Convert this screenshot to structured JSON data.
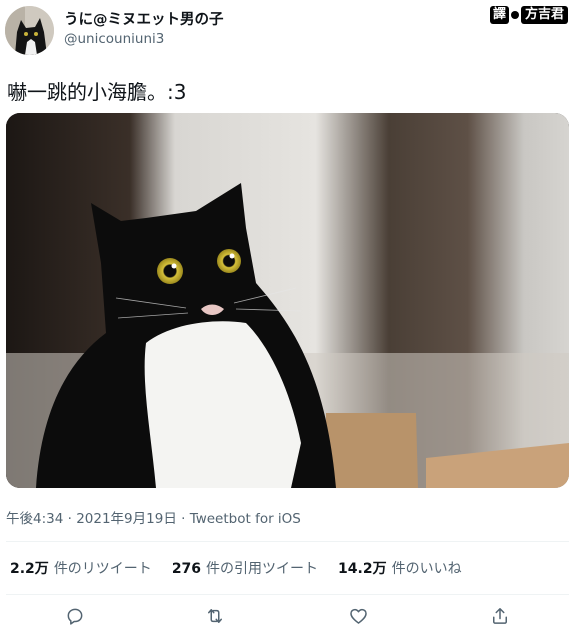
{
  "header": {
    "display_name": "うに@ミヌエット男の子",
    "username": "@unicouniuni3",
    "watermark": {
      "char": "譯",
      "name": "方吉君"
    }
  },
  "tweet": {
    "text": "嚇一跳的小海膽。:3",
    "image_icon": "tuxedo-cat-photo"
  },
  "meta": {
    "time": "午後4:34",
    "separator": " · ",
    "date": "2021年9月19日",
    "source": "Tweetbot for iOS"
  },
  "stats": [
    {
      "value": "2.2万",
      "label": "件のリツイート"
    },
    {
      "value": "276",
      "label": "件の引用ツイート"
    },
    {
      "value": "14.2万",
      "label": "件のいいね"
    }
  ],
  "actions": [
    {
      "icon": "reply-icon"
    },
    {
      "icon": "retweet-icon"
    },
    {
      "icon": "like-icon"
    },
    {
      "icon": "share-icon"
    }
  ],
  "colors": {
    "text_primary": "#0f1419",
    "text_secondary": "#536471",
    "divider": "#eff3f4"
  }
}
